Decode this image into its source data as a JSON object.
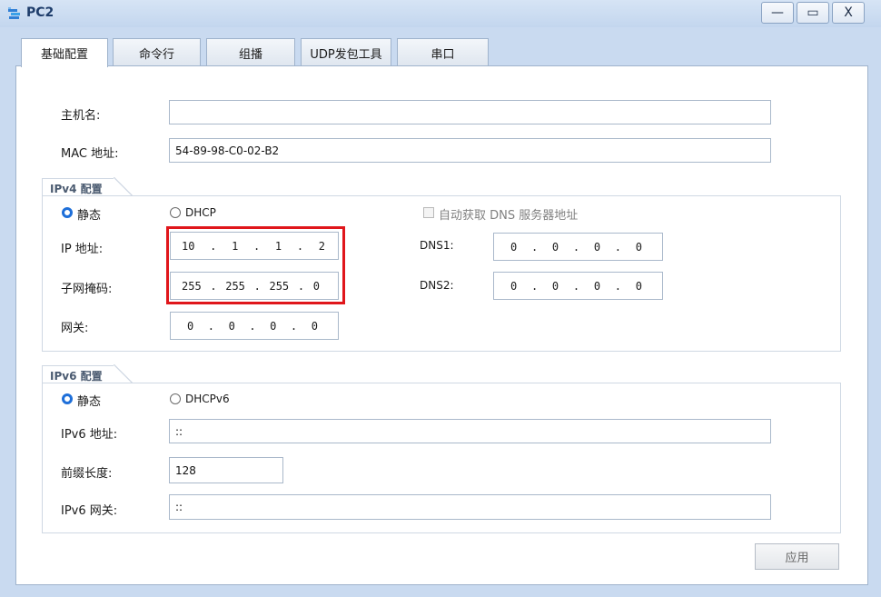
{
  "window": {
    "title": "PC2",
    "minimize_label": "—",
    "maximize_label": "▭",
    "close_label": "X"
  },
  "tabs": [
    {
      "label": "基础配置",
      "active": true
    },
    {
      "label": "命令行"
    },
    {
      "label": "组播"
    },
    {
      "label": "UDP发包工具"
    },
    {
      "label": "串口"
    }
  ],
  "host": {
    "label": "主机名:",
    "value": ""
  },
  "mac": {
    "label": "MAC 地址:",
    "value": "54-89-98-C0-02-B2"
  },
  "ipv4": {
    "title": "IPv4 配置",
    "static_label": "静态",
    "dhcp_label": "DHCP",
    "auto_dns_label": "自动获取 DNS 服务器地址",
    "ip_label": "IP 地址:",
    "ip": [
      "10",
      "1",
      "1",
      "2"
    ],
    "mask_label": "子网掩码:",
    "mask": [
      "255",
      "255",
      "255",
      "0"
    ],
    "gateway_label": "网关:",
    "gateway": [
      "0",
      "0",
      "0",
      "0"
    ],
    "dns1_label": "DNS1:",
    "dns1": [
      "0",
      "0",
      "0",
      "0"
    ],
    "dns2_label": "DNS2:",
    "dns2": [
      "0",
      "0",
      "0",
      "0"
    ]
  },
  "ipv6": {
    "title": "IPv6 配置",
    "static_label": "静态",
    "dhcp_label": "DHCPv6",
    "address_label": "IPv6 地址:",
    "address": "::",
    "prefix_label": "前缀长度:",
    "prefix": "128",
    "gateway_label": "IPv6 网关:",
    "gateway": "::"
  },
  "apply_label": "应用",
  "colors": {
    "highlight": "#e0161b",
    "radio_selected": "#1e6fd9",
    "title": "#1e3d6b"
  },
  "icons": {
    "app": "network-pc-icon"
  }
}
